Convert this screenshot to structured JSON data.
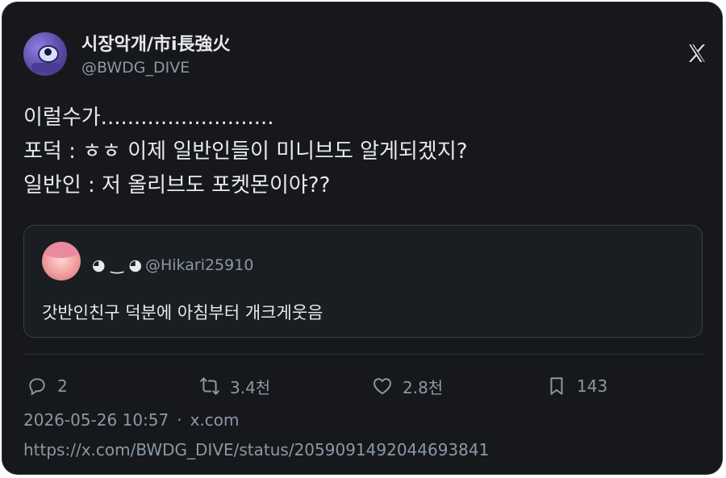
{
  "author": {
    "display_name": "시장악개/市i長強火",
    "handle": "@BWDG_DIVE",
    "avatar_icon": "octopus-avatar"
  },
  "brand_icon": "x-logo-icon",
  "tweet": {
    "lines": [
      "이럴수가..........................",
      "포덕 : ㅎㅎ 이제 일반인들이 미니브도 알게되겠지?",
      "일반인 : 저 올리브도 포켓몬이야??"
    ]
  },
  "quote": {
    "name": "◕ ‿ ◕",
    "handle": "@Hikari25910",
    "text": "갓반인친구 덕분에 아침부터 개크게웃음",
    "avatar_icon": "pink-haired-girl-avatar"
  },
  "actions": {
    "reply_count": "2",
    "retweet_count": "3.4천",
    "like_count": "2.8천",
    "bookmark_count": "143"
  },
  "meta": {
    "timestamp": "2026-05-26 10:57",
    "separator": "·",
    "source": "x.com",
    "url": "https://x.com/BWDG_DIVE/status/2059091492044693841"
  },
  "colors": {
    "background": "#16181c",
    "text": "#e7e9ea",
    "muted": "#8b98a5",
    "border": "#2f3336"
  }
}
